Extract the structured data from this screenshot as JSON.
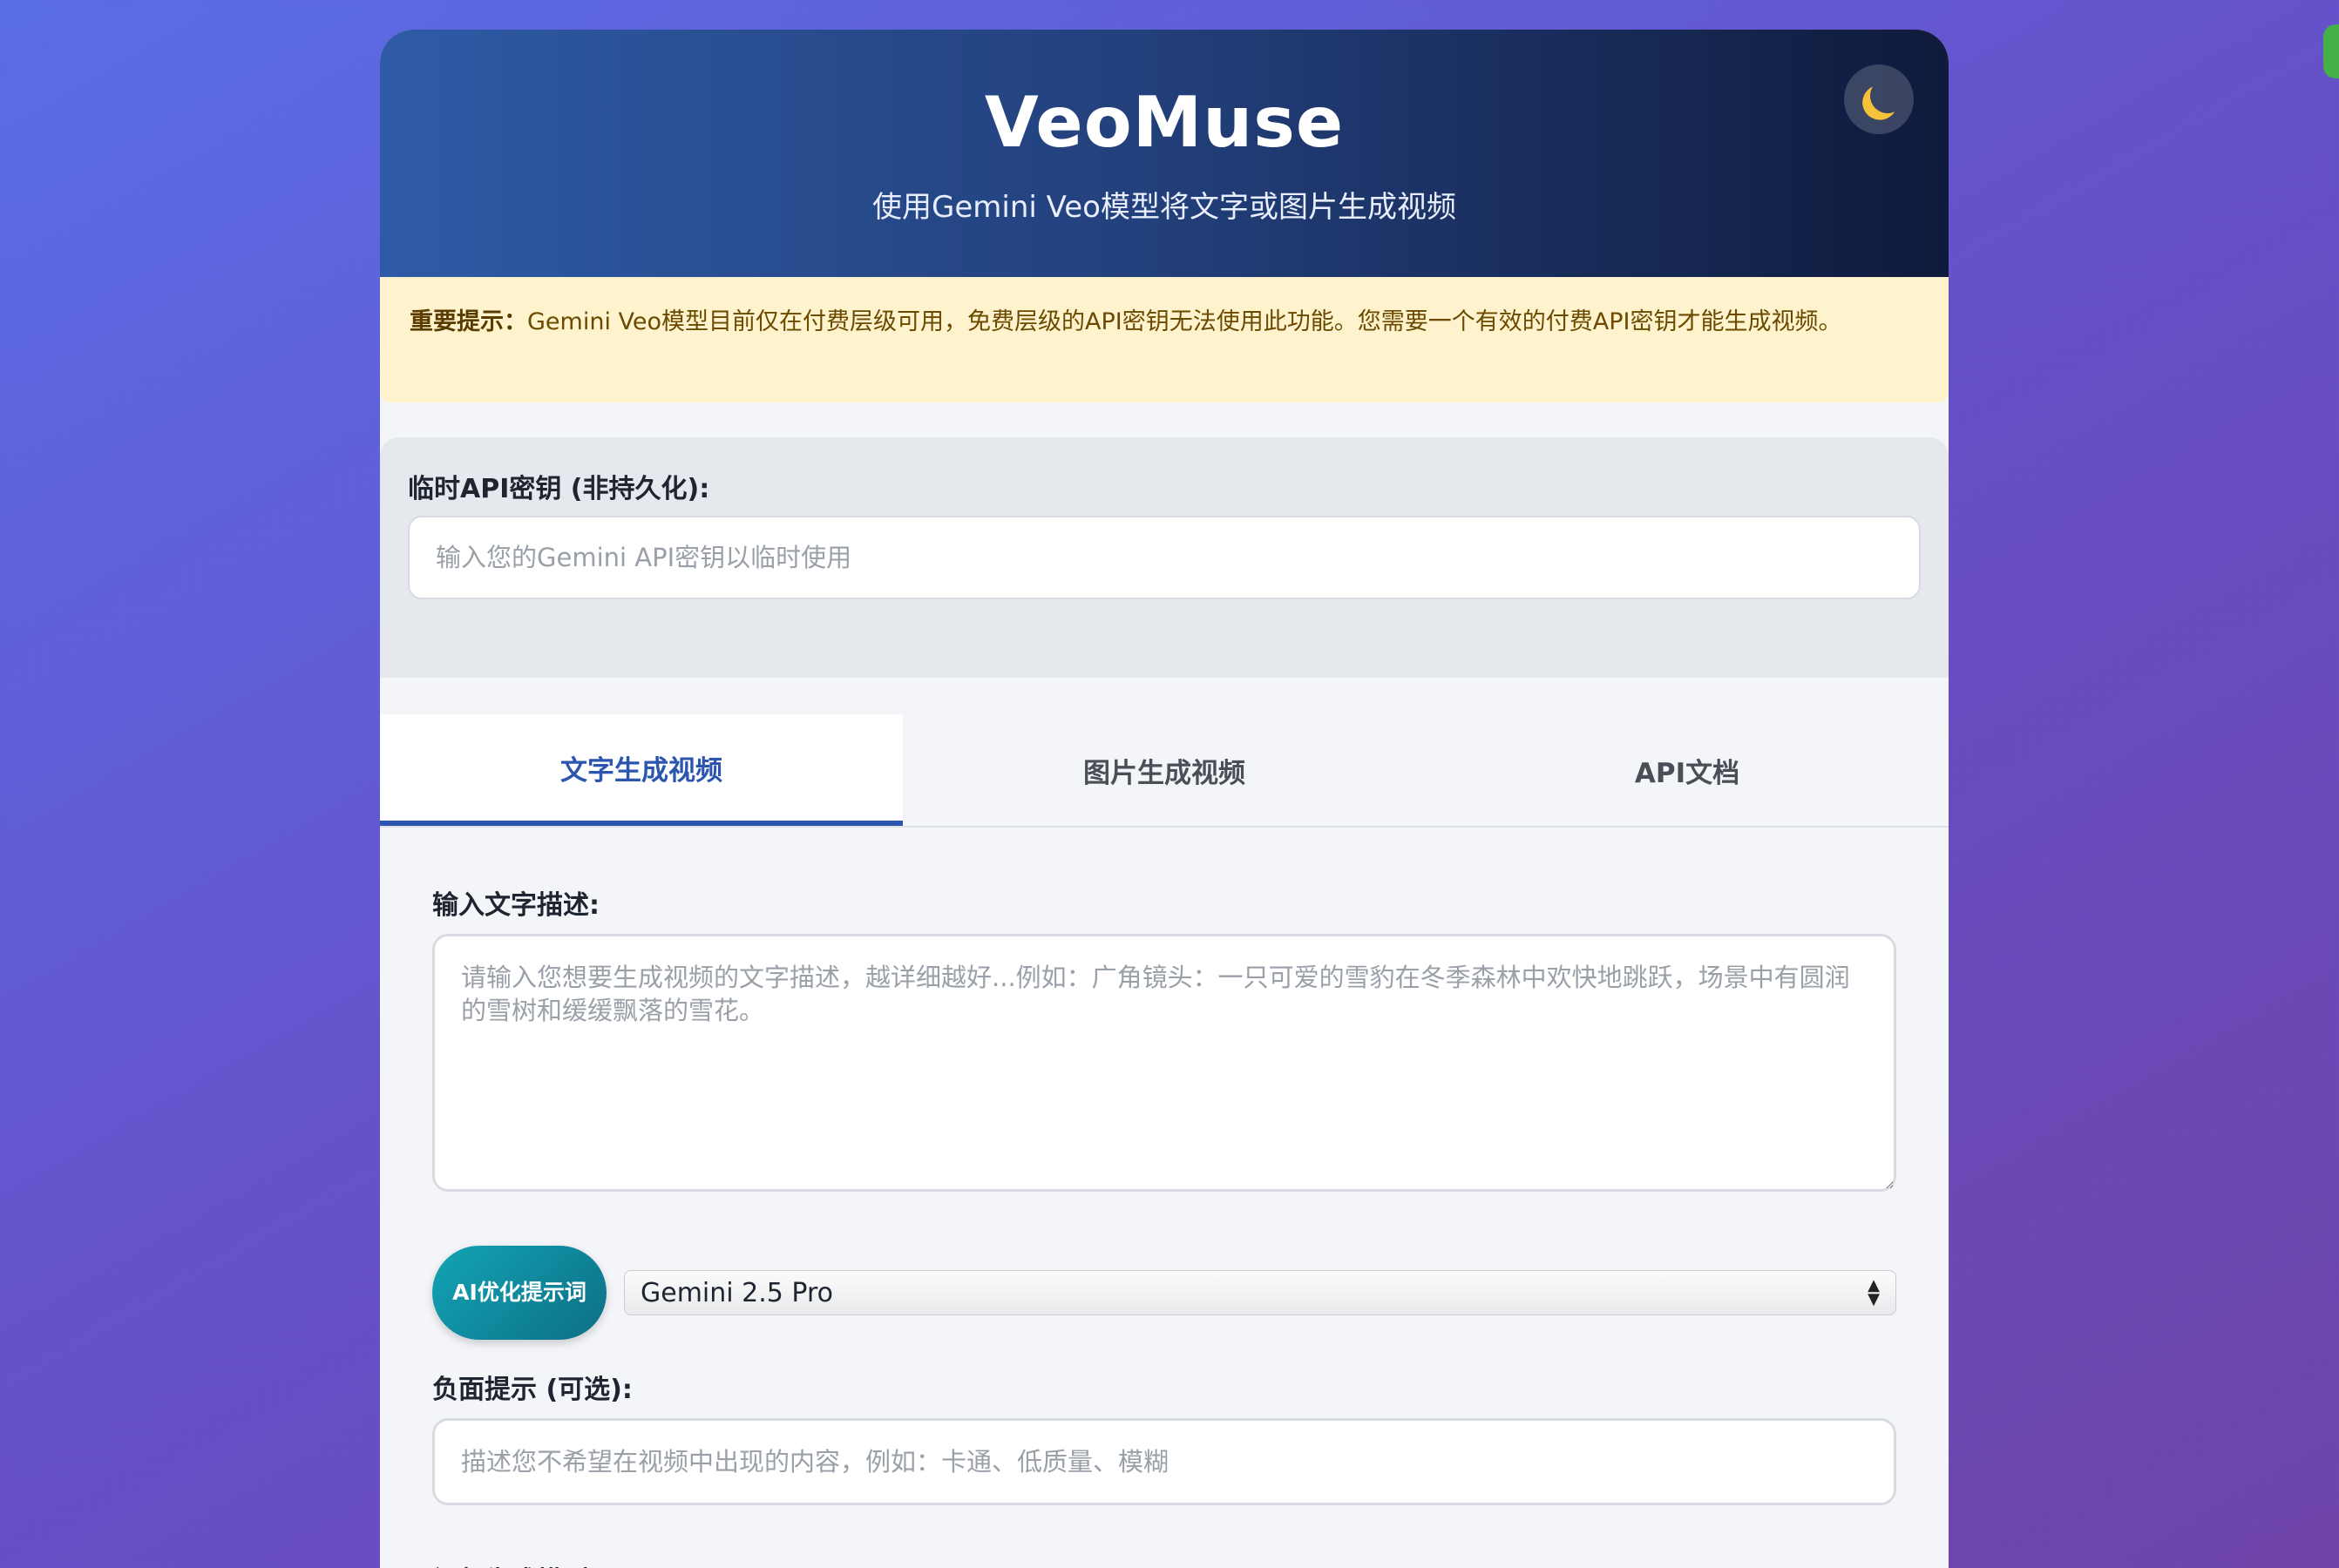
{
  "app": {
    "title": "VeoMuse",
    "subtitle": "使用Gemini Veo模型将文字或图片生成视频",
    "theme_toggle_icon": "moon-icon"
  },
  "notice": {
    "strong": "重要提示：",
    "text": "Gemini Veo模型目前仅在付费层级可用，免费层级的API密钥无法使用此功能。您需要一个有效的付费API密钥才能生成视频。"
  },
  "apikey": {
    "label": "临时API密钥 (非持久化):",
    "placeholder": "输入您的Gemini API密钥以临时使用",
    "value": ""
  },
  "tabs": [
    {
      "label": "文字生成视频",
      "active": true
    },
    {
      "label": "图片生成视频",
      "active": false
    },
    {
      "label": "API文档",
      "active": false
    }
  ],
  "text_to_video": {
    "description_label": "输入文字描述:",
    "description_placeholder": "请输入您想要生成视频的文字描述，越详细越好...例如：广角镜头：一只可爱的雪豹在冬季森林中欢快地跳跃，场景中有圆润的雪树和缓缓飘落的雪花。",
    "optimize_button": "AI优化提示词",
    "optimizer_model": "Gemini 2.5 Pro",
    "negative_label": "负面提示 (可选):",
    "negative_placeholder": "描述您不希望在视频中出现的内容，例如：卡通、低质量、模糊",
    "video_model_label": "视频生成模型:"
  },
  "colors": {
    "accent": "#2c55b0",
    "notice_bg": "#fff3cd",
    "optimize_button": "#0f8ca0",
    "side_tab": "#43b049"
  }
}
